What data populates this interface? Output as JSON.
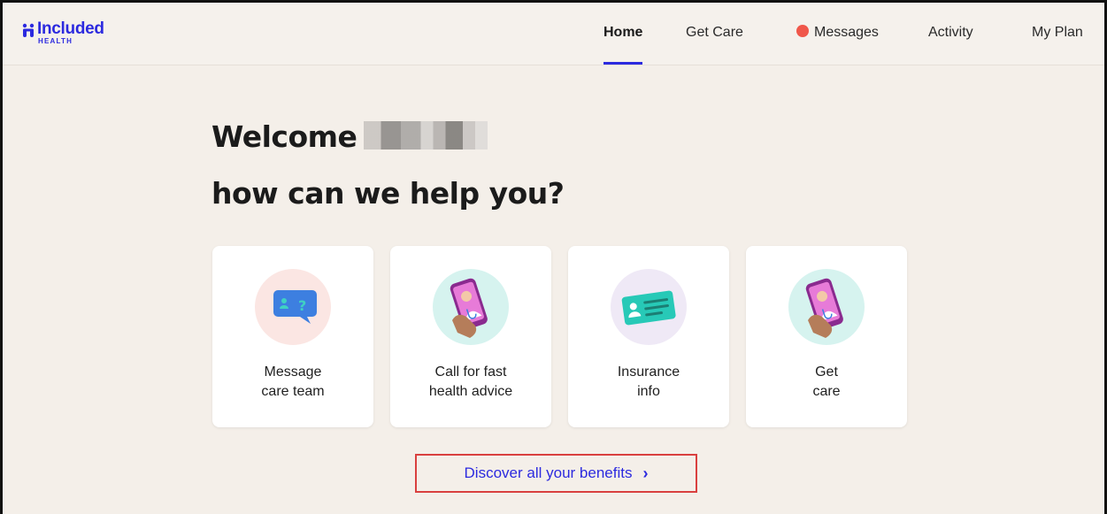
{
  "brand": {
    "name": "Included",
    "sub": "HEALTH",
    "color": "#2c2adf"
  },
  "nav": {
    "items": [
      {
        "label": "Home",
        "active": true
      },
      {
        "label": "Get Care",
        "active": false
      },
      {
        "label": "Messages",
        "active": false,
        "badge_color": "#f0574a"
      },
      {
        "label": "Activity",
        "active": false
      },
      {
        "label": "My Plan",
        "active": false
      }
    ]
  },
  "welcome": {
    "line1": "Welcome",
    "line2": "how can we help you?"
  },
  "cards": [
    {
      "line1": "Message",
      "line2": "care team",
      "icon": "chat-bubble-icon",
      "bg": "#fbe6e3"
    },
    {
      "line1": "Call for fast",
      "line2": "health advice",
      "icon": "phone-doctor-icon",
      "bg": "#d6f3ef"
    },
    {
      "line1": "Insurance",
      "line2": "info",
      "icon": "insurance-card-icon",
      "bg": "#efe9f6"
    },
    {
      "line1": "Get",
      "line2": "care",
      "icon": "phone-doctor-icon",
      "bg": "#d6f3ef"
    }
  ],
  "discover": {
    "label": "Discover all your benefits",
    "chevron": "›",
    "highlight_color": "#d9403f"
  }
}
